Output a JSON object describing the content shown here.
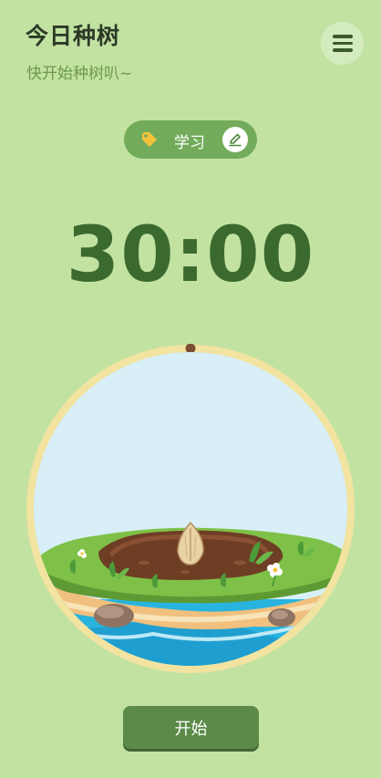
{
  "header": {
    "title": "今日种树",
    "subtitle": "快开始种树叭~"
  },
  "menu": {
    "icon": "hamburger-menu-icon"
  },
  "tag": {
    "icon": "tag-icon",
    "label": "学习",
    "edit_icon": "pencil-icon"
  },
  "timer": {
    "display": "30:00"
  },
  "scene": {
    "description_icon": "seed-island-illustration",
    "progress_fraction": 0
  },
  "actions": {
    "start_label": "开始"
  },
  "colors": {
    "background": "#c2e2a2",
    "accent": "#72ab5a",
    "timer": "#3b6a2e",
    "button": "#5b8a49"
  }
}
